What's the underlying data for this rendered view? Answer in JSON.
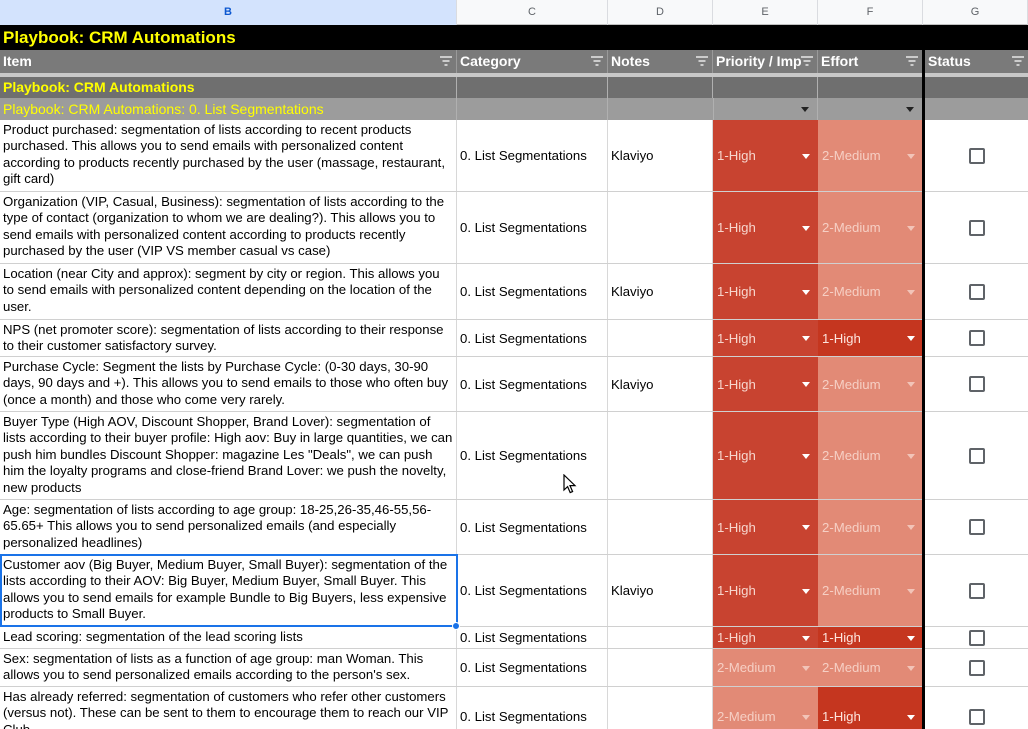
{
  "column_letters": [
    "B",
    "C",
    "D",
    "E",
    "F",
    "G"
  ],
  "title": "Playbook: CRM Automations",
  "headers": {
    "item": "Item",
    "category": "Category",
    "notes": "Notes",
    "priority": "Priority / Imp",
    "effort": "Effort",
    "status": "Status"
  },
  "group1": "Playbook: CRM Automations",
  "group2": "Playbook: CRM Automations: 0. List Segmentations",
  "colors": {
    "high": "#c5361f",
    "medium": "#e28a76",
    "priority_bg": "#c84330",
    "title_text": "#ffff00"
  },
  "rows": [
    {
      "item": "Product purchased: segmentation of lists according to recent products purchased. This allows you to send emails with personalized content according to products recently purchased by the user (massage, restaurant, gift card)",
      "category": "0. List Segmentations",
      "notes": "Klaviyo",
      "priority": "1-High",
      "effort": "2-Medium",
      "status": false
    },
    {
      "item": "Organization (VIP, Casual, Business): segmentation of lists according to the type of contact (organization to whom we are dealing?). This allows you to send emails with personalized content according to products recently purchased by the user (VIP VS member casual vs case)",
      "category": "0. List Segmentations",
      "notes": "",
      "priority": "1-High",
      "effort": "2-Medium",
      "status": false
    },
    {
      "item": "Location (near City and approx): segment by city or region. This allows you to send emails with personalized content depending on the location of the user.",
      "category": "0. List Segmentations",
      "notes": "Klaviyo",
      "priority": "1-High",
      "effort": "2-Medium",
      "status": false
    },
    {
      "item": "NPS (net promoter score): segmentation of lists according to their response to their customer satisfactory survey.",
      "category": "0. List Segmentations",
      "notes": "",
      "priority": "1-High",
      "effort": "1-High",
      "status": false
    },
    {
      "item": "Purchase Cycle: Segment the lists by Purchase Cycle: (0-30 days, 30-90 days, 90 days and +). This allows you to send emails to those who often buy (once a month) and those who come very rarely.",
      "category": "0. List Segmentations",
      "notes": "Klaviyo",
      "priority": "1-High",
      "effort": "2-Medium",
      "status": false
    },
    {
      "item": "Buyer Type (High AOV, Discount Shopper, Brand Lover): segmentation of lists according to their buyer profile: High aov: Buy in large quantities, we can push him bundles Discount Shopper: magazine Les \"Deals\", we can push him the loyalty programs and close-friend Brand Lover: we push the novelty, new products",
      "category": "0. List Segmentations",
      "notes": "",
      "priority": "1-High",
      "effort": "2-Medium",
      "status": false
    },
    {
      "item": "Age: segmentation of lists according to age group: 18-25,26-35,46-55,56-65.65+ This allows you to send personalized emails (and especially personalized headlines)",
      "category": "0. List Segmentations",
      "notes": "",
      "priority": "1-High",
      "effort": "2-Medium",
      "status": false
    },
    {
      "item": "Customer aov (Big Buyer, Medium Buyer, Small Buyer): segmentation of the lists according to their AOV: Big Buyer, Medium Buyer, Small Buyer. This allows you to send emails for example Bundle to Big Buyers, less expensive products to Small Buyer.",
      "category": "0. List Segmentations",
      "notes": "Klaviyo",
      "priority": "1-High",
      "effort": "2-Medium",
      "status": false
    },
    {
      "item": "Lead scoring: segmentation of the lead scoring lists",
      "category": "0. List Segmentations",
      "notes": "",
      "priority": "1-High",
      "effort": "1-High",
      "status": false
    },
    {
      "item": "Sex: segmentation of lists as a function of age group: man Woman. This allows you to send personalized emails according to the person's sex.",
      "category": "0. List Segmentations",
      "notes": "",
      "priority": "2-Medium",
      "effort": "2-Medium",
      "status": false
    },
    {
      "item": "Has already referred: segmentation of customers who refer other customers (versus not). These can be sent to them to encourage them to reach our VIP Club",
      "category": "0. List Segmentations",
      "notes": "",
      "priority": "2-Medium",
      "effort": "1-High",
      "status": false
    }
  ]
}
